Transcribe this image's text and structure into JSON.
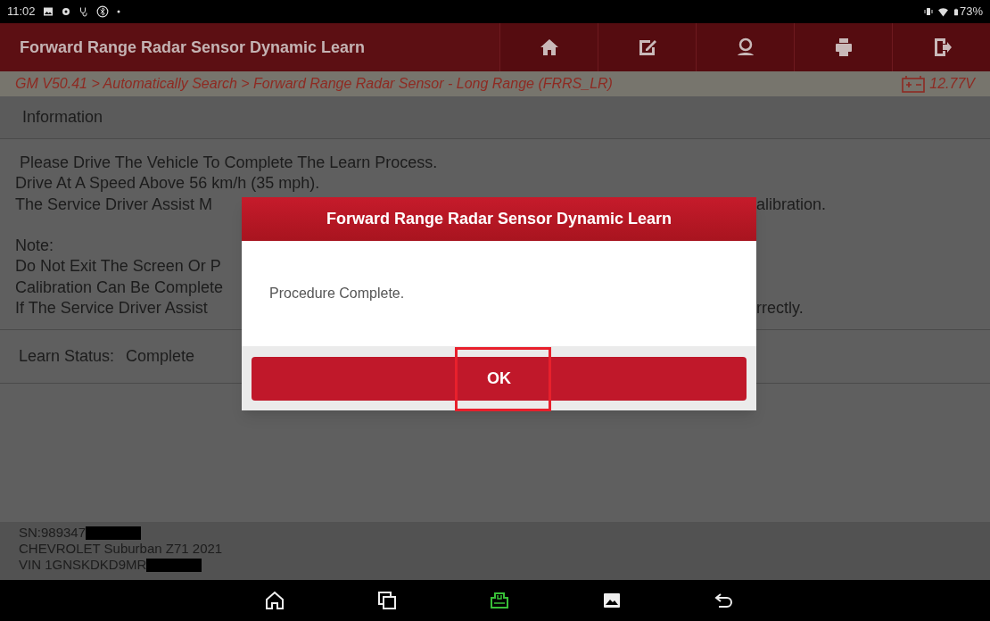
{
  "status_bar": {
    "time": "11:02",
    "battery": "73%"
  },
  "header": {
    "title": "Forward Range Radar Sensor Dynamic Learn"
  },
  "breadcrumb": {
    "path": "GM V50.41 > Automatically Search > Forward Range Radar Sensor - Long Range (FRRS_LR)",
    "voltage": "12.77V"
  },
  "section": {
    "title": "Information"
  },
  "info_blocks": [
    [
      {
        "left": " Please Drive The Vehicle To Complete The Learn Process."
      },
      {
        "left": "Drive At A Speed Above 56 km/h (35 mph)."
      },
      {
        "left": "The Service Driver Assist M",
        "right": "alibration."
      }
    ],
    [
      {
        "left": "Note:"
      },
      {
        "left": "Do Not Exit The Screen Or P"
      },
      {
        "left": "Calibration Can Be Complete"
      },
      {
        "left": "If The Service Driver Assist",
        "right": "rrectly."
      }
    ]
  ],
  "learn_status": {
    "label": "Learn Status:",
    "value": "Complete"
  },
  "footer": {
    "lines": [
      "SN:989347",
      "CHEVROLET Suburban Z71 2021",
      "VIN 1GNSKDKD9MR"
    ]
  },
  "dialog": {
    "title": "Forward Range Radar Sensor Dynamic Learn",
    "message": "Procedure Complete.",
    "button": "OK"
  }
}
